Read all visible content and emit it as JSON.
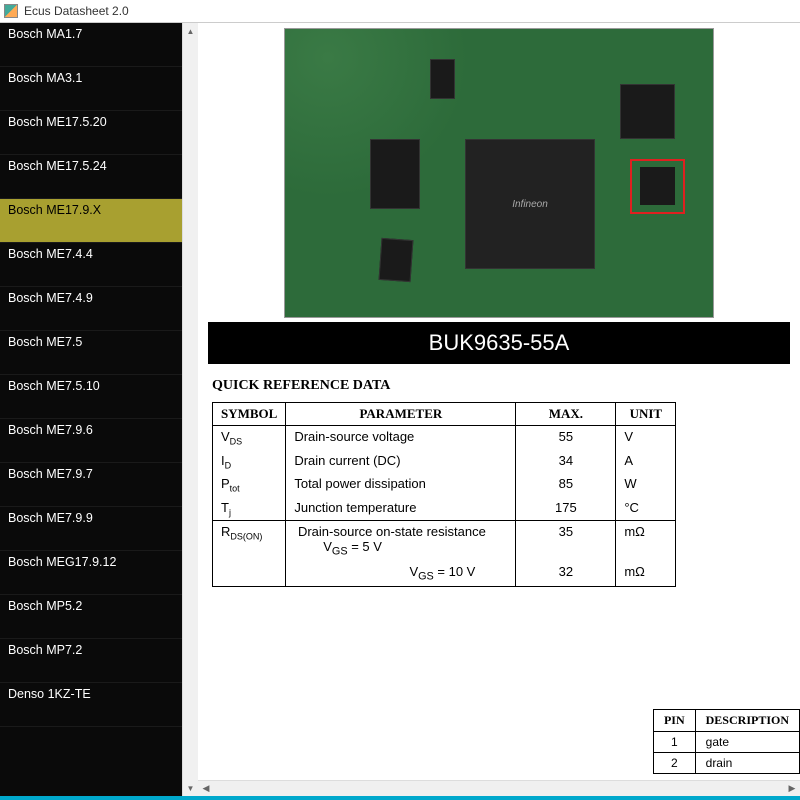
{
  "app": {
    "title": "Ecus Datasheet 2.0"
  },
  "sidebar": {
    "items": [
      {
        "label": "Bosch MA1.7"
      },
      {
        "label": "Bosch MA3.1"
      },
      {
        "label": "Bosch ME17.5.20"
      },
      {
        "label": "Bosch ME17.5.24"
      },
      {
        "label": "Bosch ME17.9.X",
        "selected": true
      },
      {
        "label": "Bosch ME7.4.4"
      },
      {
        "label": "Bosch ME7.4.9"
      },
      {
        "label": "Bosch ME7.5"
      },
      {
        "label": "Bosch ME7.5.10"
      },
      {
        "label": "Bosch ME7.9.6"
      },
      {
        "label": "Bosch ME7.9.7"
      },
      {
        "label": "Bosch ME7.9.9"
      },
      {
        "label": "Bosch MEG17.9.12"
      },
      {
        "label": "Bosch MP5.2"
      },
      {
        "label": "Bosch MP7.2"
      },
      {
        "label": "Denso 1KZ-TE"
      }
    ]
  },
  "part": {
    "chip_brand": "Infineon",
    "title": "BUK9635-55A",
    "quick_ref_heading": "QUICK REFERENCE DATA",
    "table_headers": {
      "symbol": "SYMBOL",
      "parameter": "PARAMETER",
      "max": "MAX.",
      "unit": "UNIT"
    },
    "rows": [
      {
        "sym_main": "V",
        "sym_sub": "DS",
        "param": "Drain-source voltage",
        "max": "55",
        "unit": "V"
      },
      {
        "sym_main": "I",
        "sym_sub": "D",
        "param": "Drain current (DC)",
        "max": "34",
        "unit": "A"
      },
      {
        "sym_main": "P",
        "sym_sub": "tot",
        "param": "Total power dissipation",
        "max": "85",
        "unit": "W"
      },
      {
        "sym_main": "T",
        "sym_sub": "j",
        "param": "Junction temperature",
        "max": "175",
        "unit": "°C"
      }
    ],
    "rds_row": {
      "sym_main": "R",
      "sym_sub": "DS(ON)",
      "param_text": "Drain-source on-state resistance",
      "cond1_prefix": "V",
      "cond1_sub": "GS",
      "cond1_suffix": " = 5 V",
      "cond2_prefix": "V",
      "cond2_sub": "GS",
      "cond2_suffix": " = 10 V",
      "max1": "35",
      "max2": "32",
      "unit1": "mΩ",
      "unit2": "mΩ"
    }
  },
  "pin_table": {
    "headers": {
      "pin": "PIN",
      "desc": "DESCRIPTION"
    },
    "rows": [
      {
        "pin": "1",
        "desc": "gate"
      },
      {
        "pin": "2",
        "desc": "drain"
      }
    ]
  }
}
